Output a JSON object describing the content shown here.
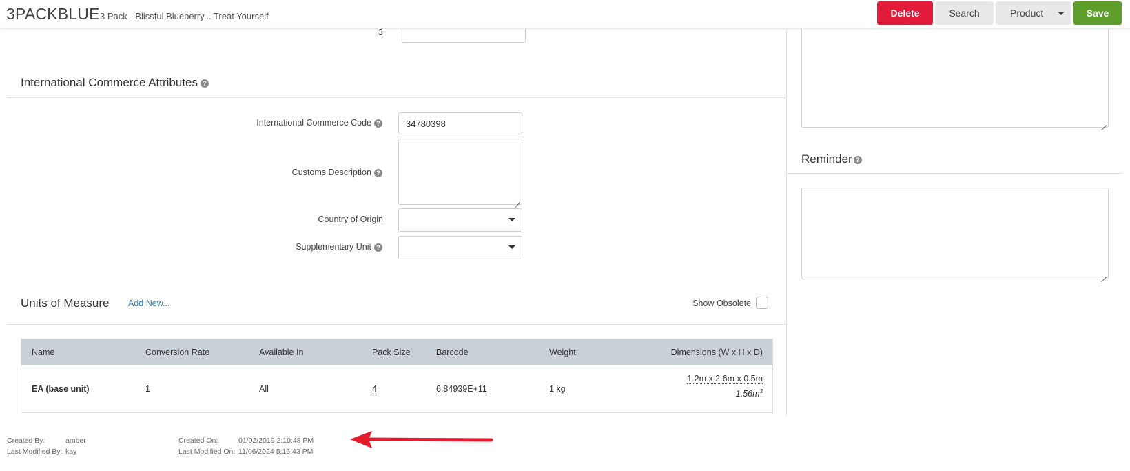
{
  "header": {
    "sku": "3PACKBLUE",
    "product_name": "3 Pack - Blissful Blueberry... Treat Yourself",
    "delete_label": "Delete",
    "search_label": "Search",
    "product_label": "Product",
    "save_label": "Save"
  },
  "top_field": {
    "label": "3",
    "value": ""
  },
  "intl": {
    "title": "International Commerce Attributes",
    "code_label": "International Commerce Code",
    "code_value": "34780398",
    "customs_label": "Customs Description",
    "customs_value": "",
    "country_label": "Country of Origin",
    "country_value": "",
    "supp_label": "Supplementary Unit",
    "supp_value": ""
  },
  "uom": {
    "title": "Units of Measure",
    "add_new_label": "Add New...",
    "show_obsolete_label": "Show Obsolete",
    "show_obsolete_checked": false,
    "columns": [
      "Name",
      "Conversion Rate",
      "Available In",
      "Pack Size",
      "Barcode",
      "Weight",
      "Dimensions (W x H x D)"
    ],
    "rows": [
      {
        "name": "EA (base unit)",
        "conversion_rate": "1",
        "available_in": "All",
        "pack_size": "4",
        "barcode": "6.84939E+11",
        "weight": "1 kg",
        "dimensions": "1.2m x 2.6m x 0.5m",
        "volume": "1.56m",
        "volume_exp": "3"
      }
    ]
  },
  "right": {
    "notes_value": "",
    "reminder_title": "Reminder",
    "reminder_value": ""
  },
  "footer": {
    "created_by_label": "Created By:",
    "created_by_value": "amber",
    "modified_by_label": "Last Modified By:",
    "modified_by_value": "kay",
    "created_on_label": "Created On:",
    "created_on_value": "01/02/2019 2:10:48 PM",
    "modified_on_label": "Last Modified On:",
    "modified_on_value": "11/06/2024 5:16:43 PM"
  },
  "colors": {
    "delete": "#e31b3b",
    "save": "#5d9d2a",
    "link": "#2a7ab5",
    "table_header": "#c9d1d8",
    "annotation_arrow": "#e31b2b"
  },
  "icons": [
    "help-icon",
    "caret-down-icon",
    "resize-handle-icon",
    "red-arrow-annotation"
  ]
}
